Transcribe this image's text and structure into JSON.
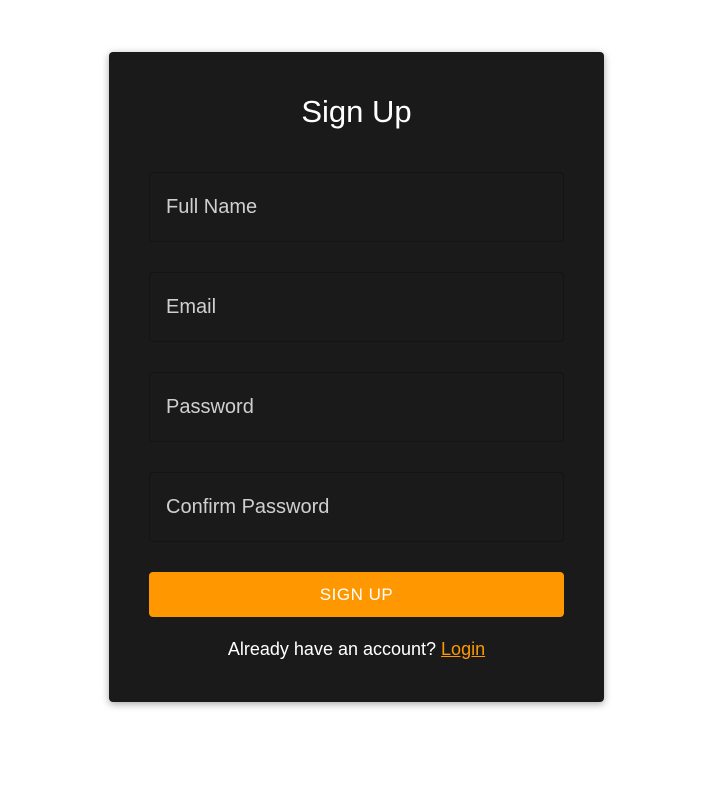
{
  "form": {
    "title": "Sign Up",
    "fields": [
      {
        "placeholder": "Full Name",
        "type": "text"
      },
      {
        "placeholder": "Email",
        "type": "email"
      },
      {
        "placeholder": "Password",
        "type": "password"
      },
      {
        "placeholder": "Confirm Password",
        "type": "password"
      }
    ],
    "submit_label": "SIGN UP",
    "footer_text": "Already have an account? ",
    "login_link": "Login"
  },
  "colors": {
    "card_background": "#1a1a1a",
    "accent": "#ff9800",
    "page_background": "#ffffff"
  }
}
